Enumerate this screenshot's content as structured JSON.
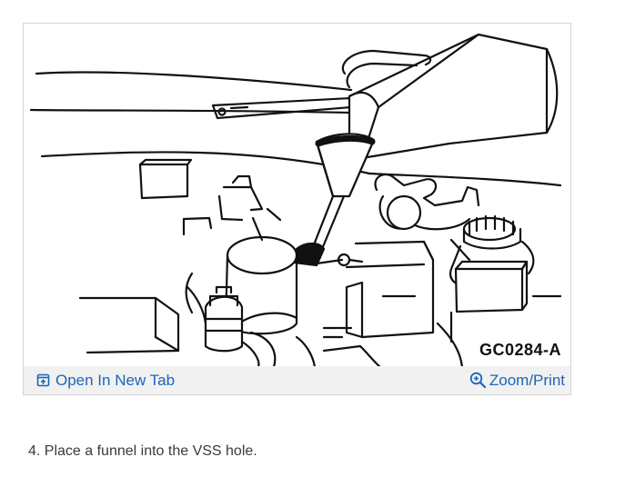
{
  "figure": {
    "code": "GC0284-A",
    "image_icon": "line-drawing-funnel-vss"
  },
  "toolbar": {
    "open_tab_label": "Open In New Tab",
    "open_tab_icon": "open-new-tab-icon",
    "zoom_label": "Zoom/Print",
    "zoom_icon": "zoom-plus-icon",
    "link_color": "#1a66b8"
  },
  "step": {
    "text": "4. Place a funnel into the VSS hole."
  }
}
